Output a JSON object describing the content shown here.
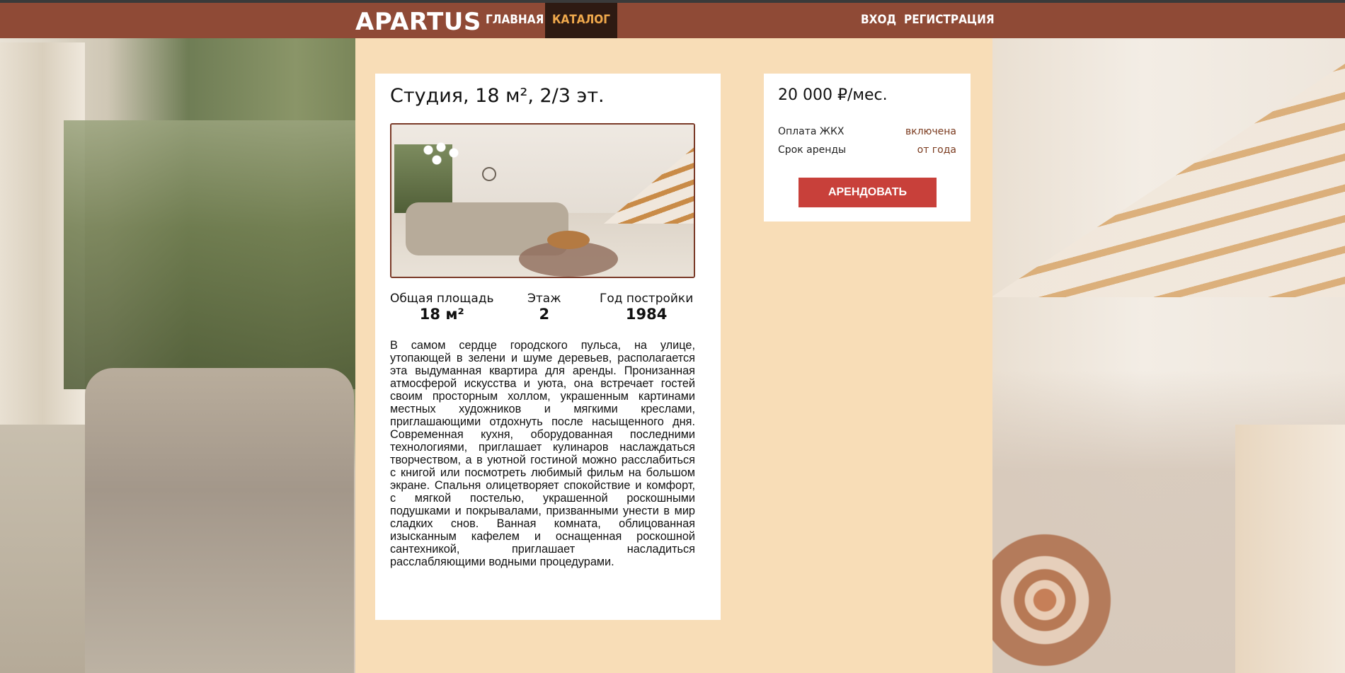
{
  "nav": {
    "logo": "APARTUS",
    "links": [
      {
        "label": "ГЛАВНАЯ",
        "active": false
      },
      {
        "label": "КАТАЛОГ",
        "active": true
      }
    ],
    "login": "ВХОД",
    "register": "РЕГИСТРАЦИЯ"
  },
  "listing": {
    "title": "Студия, 18 м², 2/3 эт.",
    "stats": [
      {
        "label": "Общая площадь",
        "value": "18 м²"
      },
      {
        "label": "Этаж",
        "value": "2"
      },
      {
        "label": "Год постройки",
        "value": "1984"
      }
    ],
    "description": "В самом сердце городского пульса, на улице, утопающей в зелени и шуме деревьев, располагается эта выдуманная квартира для аренды. Пронизанная атмосферой искусства и уюта, она встречает гостей своим просторным холлом, украшенным картинами местных художников и мягкими креслами, приглашающими отдохнуть после насыщенного дня. Современная кухня, оборудованная последними технологиями, приглашает кулинаров наслаждаться творчеством, а в уютной гостиной можно расслабиться с книгой или посмотреть любимый фильм на большом экране. Спальня олицетворяет спокойствие и комфорт, с мягкой постелью, украшенной роскошными подушками и покрывалами, призванными унести в мир сладких снов. Ванная комната, облицованная изысканным кафелем и оснащенная роскошной сантехникой, приглашает насладиться расслабляющими водными процедурами."
  },
  "pricing": {
    "price": "20 000 ₽/мес.",
    "rows": [
      {
        "key": "Оплата ЖКХ",
        "value": "включена"
      },
      {
        "key": "Срок аренды",
        "value": "от года"
      }
    ],
    "button": "АРЕНДОВАТЬ"
  },
  "colors": {
    "navbar": "#8f4a36",
    "nav_active_bg": "#2e1a12",
    "nav_active_text": "#f0a94c",
    "column_bg": "#f8ddb7",
    "button": "#c8403a"
  }
}
